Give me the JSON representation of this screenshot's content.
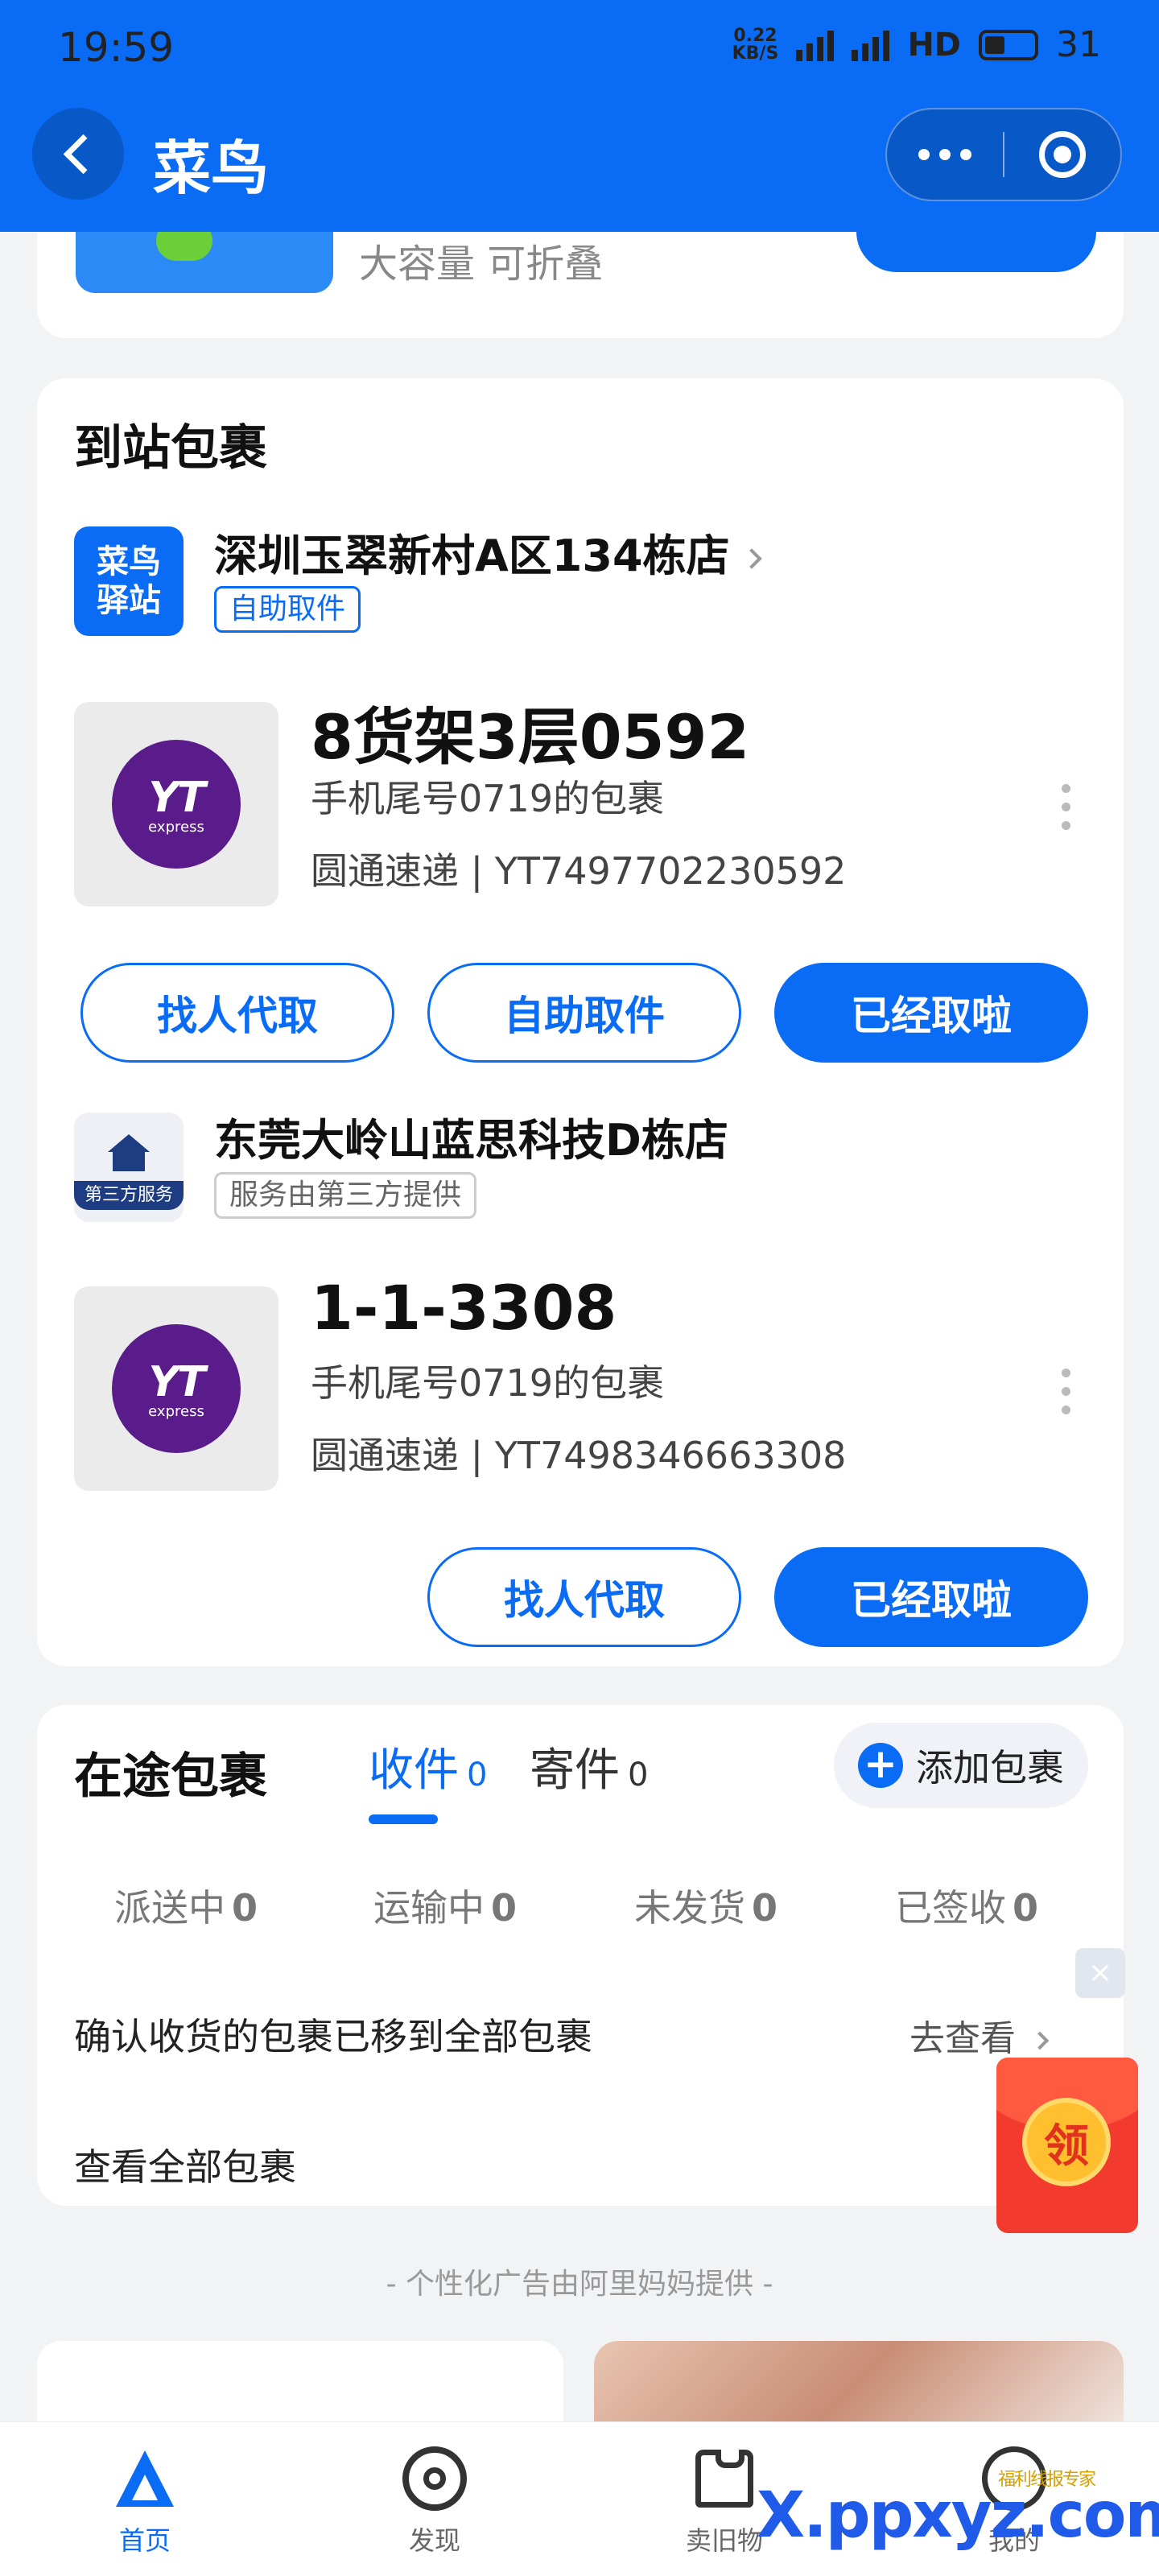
{
  "status_bar": {
    "time": "19:59",
    "net_speed_value": "0.22",
    "net_speed_unit": "KB/S",
    "sig1": "5G",
    "sig2": "4G",
    "hd": "HD",
    "battery": "31"
  },
  "nav": {
    "title": "菜鸟"
  },
  "promo": {
    "text": "大容量 可折叠"
  },
  "arrived": {
    "title": "到站包裹",
    "stations": [
      {
        "logo_text": "菜鸟驿站",
        "name": "深圳玉翠新村A区134栋店",
        "tag": "自助取件",
        "package": {
          "code": "8货架3层0592",
          "desc": "手机尾号0719的包裹",
          "carrier": "圆通速递 | YT7497702230592",
          "logo_main": "YT",
          "logo_sub": "express"
        },
        "buttons": [
          "找人代取",
          "自助取件",
          "已经取啦"
        ]
      },
      {
        "logo_tag": "第三方服务",
        "name": "东莞大岭山蓝思科技D栋店",
        "tag": "服务由第三方提供",
        "package": {
          "code": "1-1-3308",
          "desc": "手机尾号0719的包裹",
          "carrier": "圆通速递 | YT7498346663308",
          "logo_main": "YT",
          "logo_sub": "express"
        },
        "buttons": [
          "找人代取",
          "已经取啦"
        ]
      }
    ]
  },
  "in_transit": {
    "title": "在途包裹",
    "tabs": [
      {
        "label": "收件",
        "count": "0"
      },
      {
        "label": "寄件",
        "count": "0"
      }
    ],
    "add_label": "添加包裹",
    "stats": [
      {
        "label": "派送中",
        "count": "0"
      },
      {
        "label": "运输中",
        "count": "0"
      },
      {
        "label": "未发货",
        "count": "0"
      },
      {
        "label": "已签收",
        "count": "0"
      }
    ],
    "notice": "确认收货的包裹已移到全部包裹",
    "goto": "去查看",
    "view_all": "查看全部包裹"
  },
  "floating": {
    "close": "×",
    "redpacket": "领"
  },
  "ad_note": "- 个性化广告由阿里妈妈提供 -",
  "tabbar": {
    "items": [
      "首页",
      "发现",
      "卖旧物",
      "我的"
    ]
  },
  "watermark": {
    "main": "X.ppxyz.com",
    "small": "福利线报专家"
  },
  "colors": {
    "primary": "#0a6cf5",
    "yto": "#5a1c8a"
  }
}
